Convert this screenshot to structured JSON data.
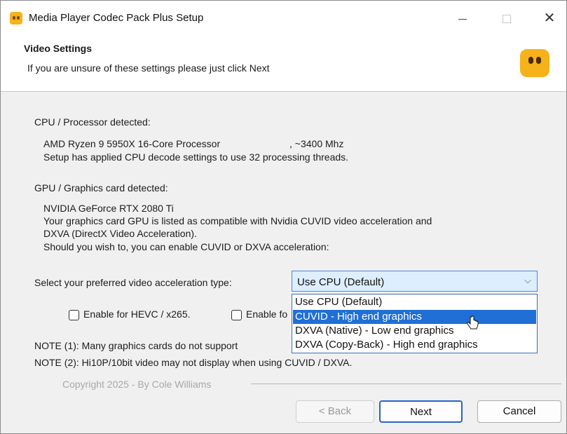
{
  "window": {
    "title": "Media Player Codec Pack Plus Setup",
    "minimize_icon": "minimize-icon",
    "maximize_icon": "maximize-icon",
    "close_icon": "✕"
  },
  "header": {
    "title": "Video Settings",
    "subtitle": "If you are unsure of these settings please just click Next"
  },
  "cpu": {
    "label": "CPU / Processor detected:",
    "name": "AMD Ryzen 9 5950X 16-Core Processor",
    "speed": ", ~3400 Mhz",
    "note": "Setup has applied CPU decode settings to use 32 processing threads."
  },
  "gpu": {
    "label": "GPU / Graphics card detected:",
    "name": "NVIDIA GeForce RTX 2080 Ti",
    "line1": "Your graphics card GPU is listed as compatible with Nvidia  CUVID video acceleration and",
    "line2": "DXVA (DirectX  Video Acceleration).",
    "line3": "Should you wish to, you can enable CUVID or DXVA acceleration:"
  },
  "acceleration": {
    "label": "Select your preferred video acceleration type:",
    "selected": "Use CPU (Default)",
    "options": [
      "Use CPU (Default)",
      "CUVID - High end graphics",
      "DXVA (Native) - Low end graphics",
      "DXVA (Copy-Back) - High end graphics"
    ],
    "highlighted_index": 1
  },
  "checkboxes": {
    "hevc_label": "Enable for HEVC / x265.",
    "second_label": "Enable fo"
  },
  "notes": {
    "note1": "NOTE (1): Many graphics cards do not support",
    "note2": "NOTE (2): Hi10P/10bit video may not display when using CUVID / DXVA."
  },
  "footer": {
    "copyright": "Copyright 2025 - By Cole Williams"
  },
  "buttons": {
    "back": "< Back",
    "next": "Next",
    "cancel": "Cancel"
  },
  "colors": {
    "accent": "#1f6fd6",
    "logo": "#f5b21b",
    "select_bg": "#ddeeff"
  }
}
